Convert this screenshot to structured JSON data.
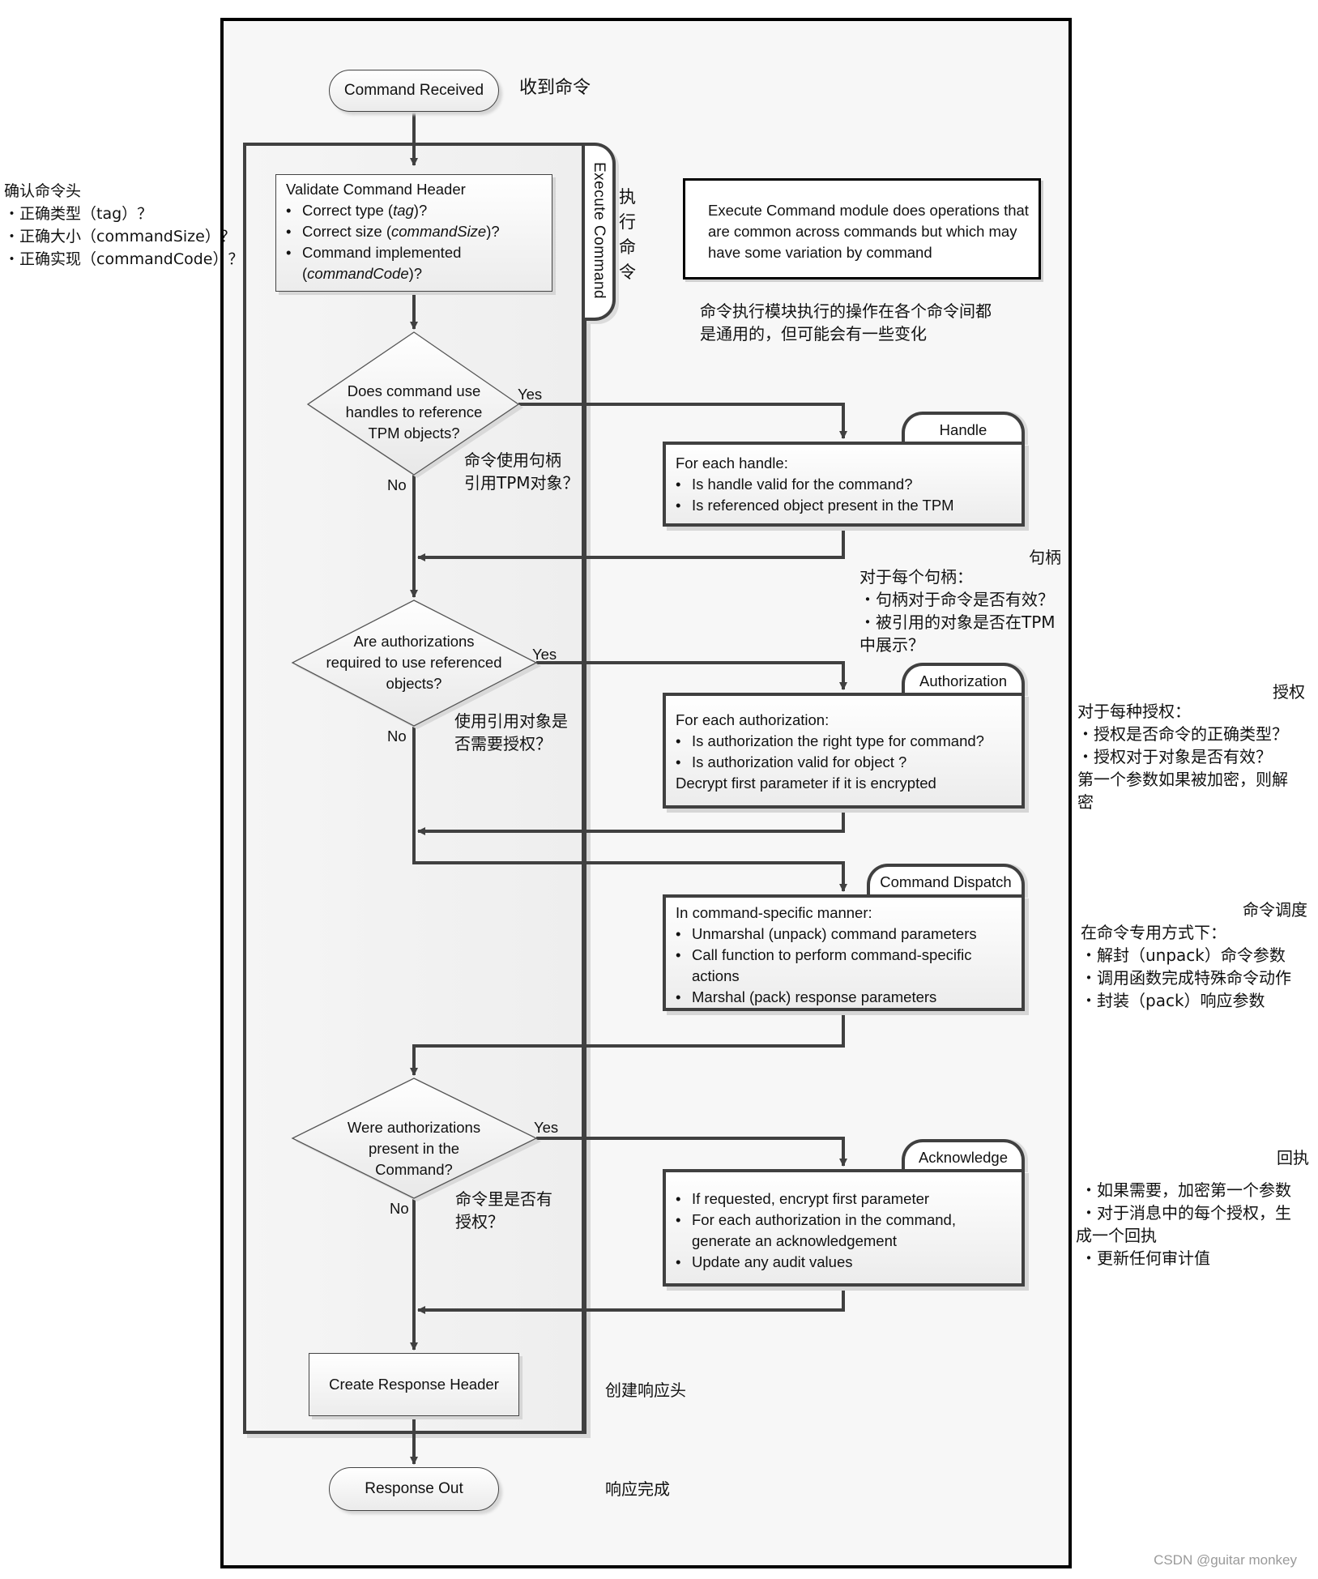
{
  "diagram": {
    "start": "Command Received",
    "start_cn": "收到命令",
    "container_label": "Execute Command",
    "container_label_cn": [
      "执",
      "行",
      "命",
      "令"
    ],
    "validate": {
      "title": "Validate Command Header",
      "items": [
        {
          "text": "Correct type (",
          "em": "tag",
          "tail": ")?"
        },
        {
          "text": "Correct size (",
          "em": "commandSize",
          "tail": ")?"
        },
        {
          "text": "Command implemented",
          "line2_pre": "(",
          "em": "commandCode",
          "tail": ")?"
        }
      ],
      "cn_title": "确认命令头",
      "cn_items": [
        "・正确类型（tag）？",
        "・正确大小（commandSize）？",
        "・正确实现（commandCode）？"
      ]
    },
    "note": {
      "text": "Execute Command module does operations that are common across commands but which may have some variation by command",
      "cn_lines": [
        "命令执行模块执行的操作在各个命令间都",
        "是通用的，但可能会有一些变化"
      ]
    },
    "decision_handles": {
      "lines": [
        "Does command use",
        "handles to reference",
        "TPM objects?"
      ],
      "yes": "Yes",
      "no": "No",
      "cn_lines": [
        "命令使用句柄",
        "引用TPM对象？"
      ]
    },
    "handle": {
      "tab": "Handle",
      "intro": "For each handle:",
      "items": [
        "Is handle valid for the command?",
        "Is referenced object present in the TPM"
      ],
      "cn_title": "句柄",
      "cn_lines": [
        "对于每个句柄：",
        "・句柄对于命令是否有效？",
        "・被引用的对象是否在TPM",
        "中展示？"
      ]
    },
    "decision_auth": {
      "lines": [
        "Are authorizations",
        "required to use referenced",
        "objects?"
      ],
      "yes": "Yes",
      "no": "No",
      "cn_lines": [
        "使用引用对象是",
        "否需要授权？"
      ]
    },
    "authorization": {
      "tab": "Authorization",
      "intro": "For each authorization:",
      "items": [
        "Is authorization the right type for command?",
        "Is authorization valid for object ?"
      ],
      "outro": "Decrypt first parameter if it is encrypted",
      "cn_title": "授权",
      "cn_lines": [
        "对于每种授权：",
        "・授权是否命令的正确类型？",
        "・授权对于对象是否有效？",
        "第一个参数如果被加密，则解",
        "密"
      ]
    },
    "dispatch": {
      "tab": "Command Dispatch",
      "intro": "In command-specific manner:",
      "items": [
        "Unmarshal (unpack) command parameters",
        "Call function to perform command-specific actions",
        "Marshal (pack) response parameters"
      ],
      "cn_title": "命令调度",
      "cn_lines": [
        "在命令专用方式下：",
        "・解封（unpack）命令参数",
        "・调用函数完成特殊命令动作",
        "・封装（pack）响应参数"
      ]
    },
    "decision_present": {
      "lines": [
        "Were authorizations",
        "present in the",
        "Command?"
      ],
      "yes": "Yes",
      "no": "No",
      "cn_lines": [
        "命令里是否有",
        "授权？"
      ]
    },
    "acknowledge": {
      "tab": "Acknowledge",
      "items": [
        "If requested, encrypt first parameter",
        "For each authorization in the command, generate an acknowledgement",
        "Update any audit values"
      ],
      "cn_title": "回执",
      "cn_lines": [
        "・如果需要，加密第一个参数",
        "・对于消息中的每个授权，生",
        "成一个回执",
        "・更新任何审计值"
      ]
    },
    "create_response": "Create Response Header",
    "create_response_cn": "创建响应头",
    "end": "Response Out",
    "end_cn": "响应完成"
  },
  "watermark": "CSDN @guitar monkey"
}
